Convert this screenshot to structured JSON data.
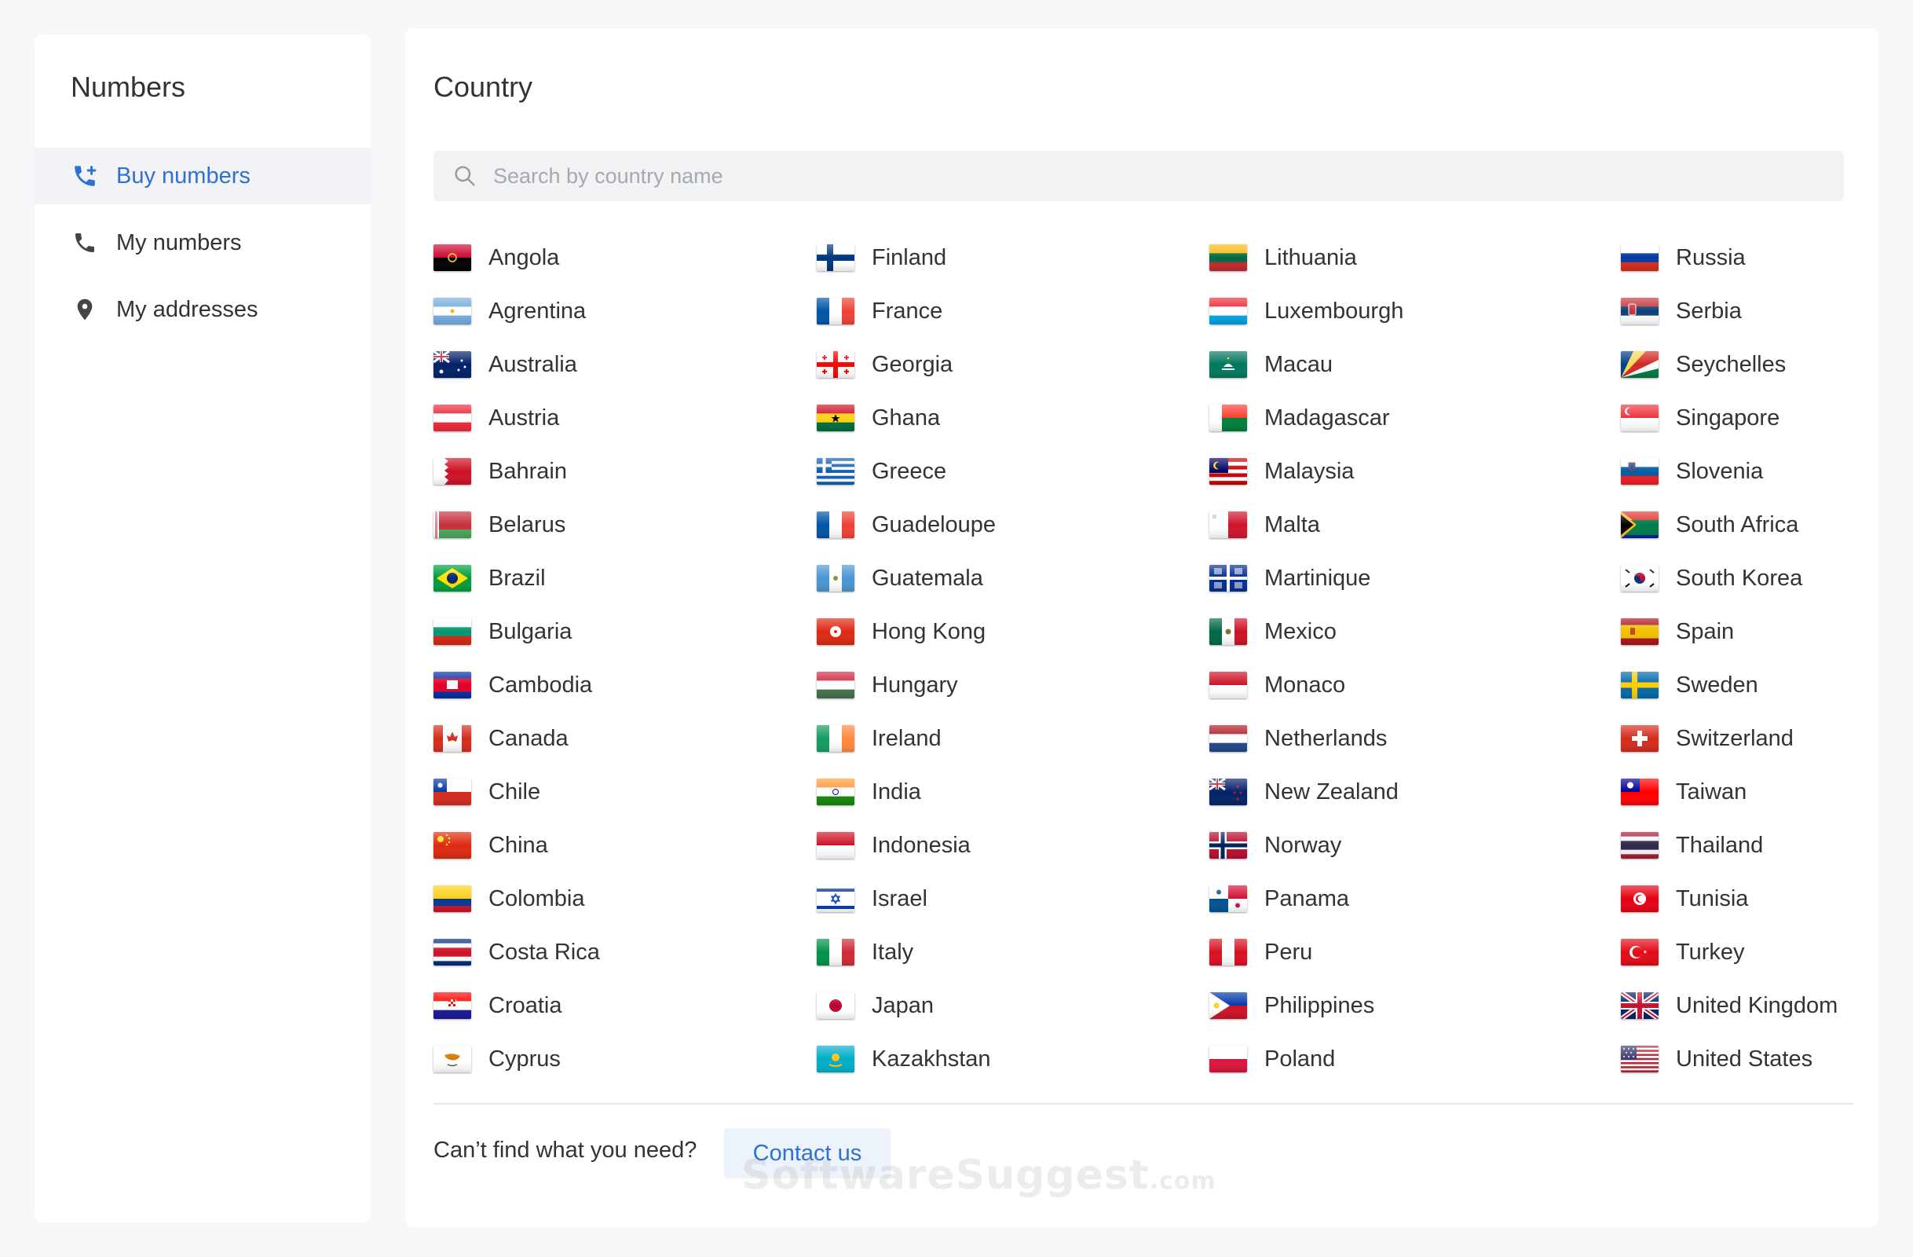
{
  "sidebar": {
    "title": "Numbers",
    "items": [
      {
        "label": "Buy numbers",
        "icon": "phone-add-icon",
        "active": true
      },
      {
        "label": "My numbers",
        "icon": "phone-icon",
        "active": false
      },
      {
        "label": "My addresses",
        "icon": "location-pin-icon",
        "active": false
      }
    ]
  },
  "main": {
    "title": "Country",
    "search": {
      "placeholder": "Search by country name",
      "value": ""
    },
    "countries": [
      [
        "Angola",
        "Agrentina",
        "Australia",
        "Austria",
        "Bahrain",
        "Belarus",
        "Brazil",
        "Bulgaria",
        "Cambodia",
        "Canada",
        "Chile",
        "China",
        "Colombia",
        "Costa Rica",
        "Croatia",
        "Cyprus"
      ],
      [
        "Finland",
        "France",
        "Georgia",
        "Ghana",
        "Greece",
        "Guadeloupe",
        "Guatemala",
        "Hong Kong",
        "Hungary",
        "Ireland",
        "India",
        "Indonesia",
        "Israel",
        "Italy",
        "Japan",
        "Kazakhstan"
      ],
      [
        "Lithuania",
        "Luxembourgh",
        "Macau",
        "Madagascar",
        "Malaysia",
        "Malta",
        "Martinique",
        "Mexico",
        "Monaco",
        "Netherlands",
        "New Zealand",
        "Norway",
        "Panama",
        "Peru",
        "Philippines",
        "Poland"
      ],
      [
        "Russia",
        "Serbia",
        "Seychelles",
        "Singapore",
        "Slovenia",
        "South Africa",
        "South Korea",
        "Spain",
        "Sweden",
        "Switzerland",
        "Taiwan",
        "Thailand",
        "Tunisia",
        "Turkey",
        "United Kingdom",
        "United States"
      ]
    ],
    "footer": {
      "prompt": "Can’t find what you need?",
      "contact_label": "Contact us"
    }
  },
  "watermark": {
    "main": "SoftwareSuggest",
    "suffix": ".com"
  },
  "colors": {
    "accent": "#2f6fd6",
    "active_bg": "#f1f3f6",
    "panel_bg": "#ffffff",
    "page_bg": "#f6f7f9"
  }
}
